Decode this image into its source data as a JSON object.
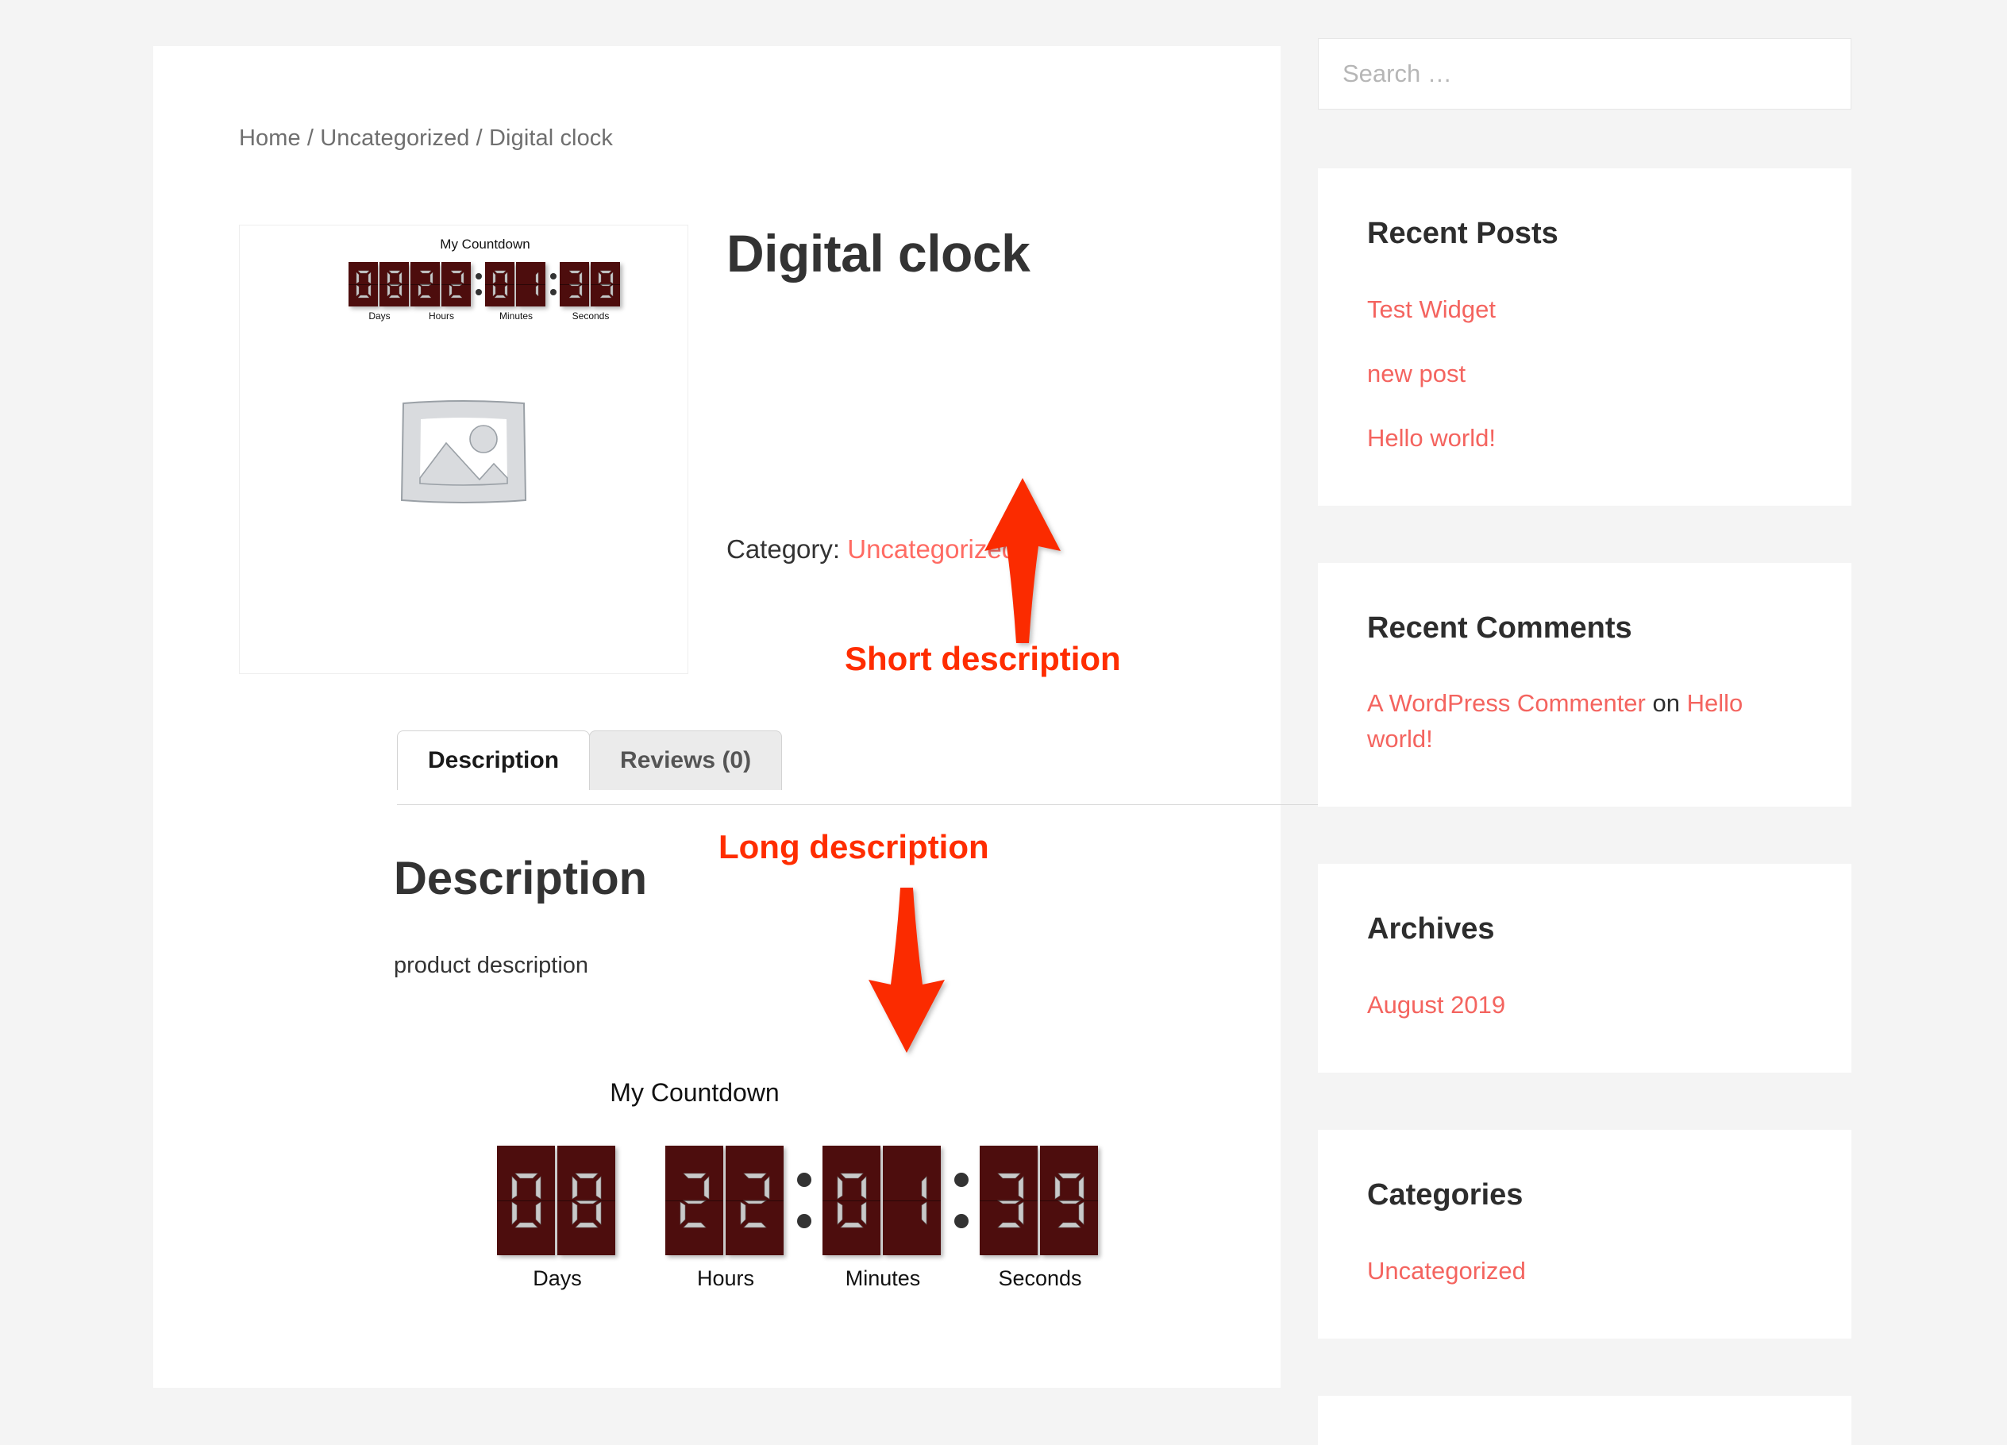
{
  "theme": {
    "page_background": "#f4f4f4",
    "card_background": "#ffffff",
    "link_color": "#f4645f",
    "heading_color": "#333333",
    "annotation_color": "#ff2d00",
    "countdown_panel_color": "#4d0d0d",
    "countdown_digit_color": "#c9c9c9"
  },
  "breadcrumb": {
    "text": "Home / Uncategorized / Digital clock",
    "items": [
      "Home",
      "Uncategorized",
      "Digital clock"
    ],
    "separator": "/"
  },
  "product": {
    "title": "Digital clock",
    "image_placeholder_icon": "image-placeholder-icon",
    "category_label": "Category:",
    "category_value": "Uncategorized"
  },
  "countdown_short": {
    "title": "My Countdown",
    "separator_glyph": ":",
    "units": [
      {
        "label": "Days",
        "value": "08",
        "digits": [
          "0",
          "8"
        ]
      },
      {
        "label": "Hours",
        "value": "22",
        "digits": [
          "2",
          "2"
        ]
      },
      {
        "label": "Minutes",
        "value": "01",
        "digits": [
          "0",
          "1"
        ]
      },
      {
        "label": "Seconds",
        "value": "39",
        "digits": [
          "3",
          "9"
        ]
      }
    ]
  },
  "countdown_long": {
    "title": "My Countdown",
    "separator_glyph": ":",
    "units": [
      {
        "label": "Days",
        "value": "08",
        "digits": [
          "0",
          "8"
        ]
      },
      {
        "label": "Hours",
        "value": "22",
        "digits": [
          "2",
          "2"
        ]
      },
      {
        "label": "Minutes",
        "value": "01",
        "digits": [
          "0",
          "1"
        ]
      },
      {
        "label": "Seconds",
        "value": "39",
        "digits": [
          "3",
          "9"
        ]
      }
    ]
  },
  "tabs": [
    {
      "label": "Description",
      "active": true
    },
    {
      "label": "Reviews (0)",
      "active": false
    }
  ],
  "description_panel": {
    "heading": "Description",
    "body": "product description"
  },
  "annotations": [
    {
      "id": "short",
      "text": "Short description",
      "arrow": "arrow-up-icon"
    },
    {
      "id": "long",
      "text": "Long description",
      "arrow": "arrow-down-icon"
    }
  ],
  "sidebar": {
    "search": {
      "placeholder": "Search …",
      "value": ""
    },
    "widgets": [
      {
        "title": "Recent Posts",
        "items": [
          {
            "text": "Test Widget"
          },
          {
            "text": "new post"
          },
          {
            "text": "Hello world!"
          }
        ]
      },
      {
        "title": "Recent Comments",
        "items": [
          {
            "author": "A WordPress Commenter",
            "connector": "on",
            "post": "Hello world!"
          }
        ]
      },
      {
        "title": "Archives",
        "items": [
          {
            "text": "August 2019"
          }
        ]
      },
      {
        "title": "Categories",
        "items": [
          {
            "text": "Uncategorized"
          }
        ]
      }
    ]
  }
}
